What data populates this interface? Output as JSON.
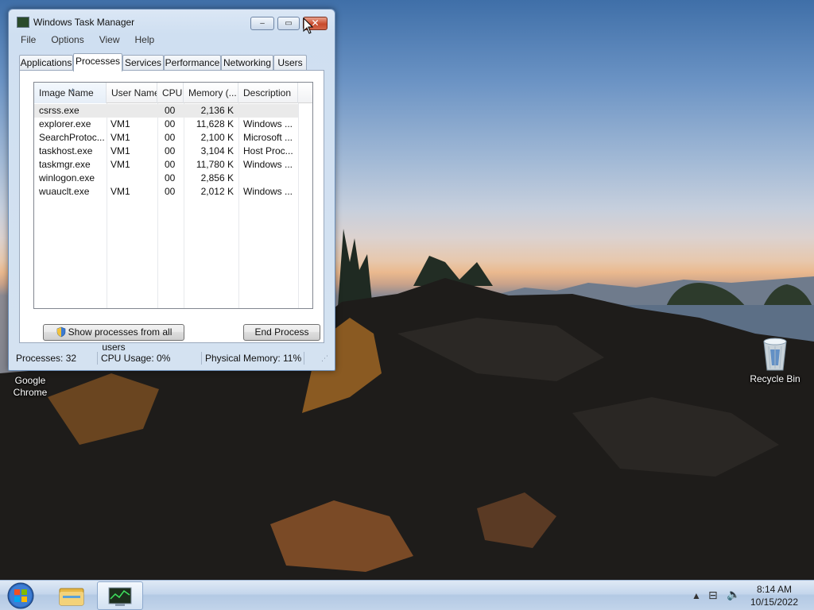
{
  "desktop": {
    "icons": [
      {
        "label_line1": "Google",
        "label_line2": "Chrome",
        "icon": "chrome-icon"
      },
      {
        "label_line1": "Recycle Bin",
        "icon": "recycle-bin-icon"
      }
    ]
  },
  "window": {
    "title": "Windows Task Manager",
    "controls": {
      "minimize": "–",
      "maximize": "▭",
      "close": "✕"
    },
    "menu": [
      "File",
      "Options",
      "View",
      "Help"
    ],
    "tabs": [
      "Applications",
      "Processes",
      "Services",
      "Performance",
      "Networking",
      "Users"
    ],
    "selected_tab": "Processes",
    "columns": [
      "Image Name",
      "User Name",
      "CPU",
      "Memory (...",
      "Description"
    ],
    "rows": [
      {
        "image": "csrss.exe",
        "user": "",
        "cpu": "00",
        "memory": "2,136 K",
        "desc": ""
      },
      {
        "image": "explorer.exe",
        "user": "VM1",
        "cpu": "00",
        "memory": "11,628 K",
        "desc": "Windows ..."
      },
      {
        "image": "SearchProtoc...",
        "user": "VM1",
        "cpu": "00",
        "memory": "2,100 K",
        "desc": "Microsoft ..."
      },
      {
        "image": "taskhost.exe",
        "user": "VM1",
        "cpu": "00",
        "memory": "3,104 K",
        "desc": "Host Proc..."
      },
      {
        "image": "taskmgr.exe",
        "user": "VM1",
        "cpu": "00",
        "memory": "11,780 K",
        "desc": "Windows ..."
      },
      {
        "image": "winlogon.exe",
        "user": "",
        "cpu": "00",
        "memory": "2,856 K",
        "desc": ""
      },
      {
        "image": "wuauclt.exe",
        "user": "VM1",
        "cpu": "00",
        "memory": "2,012 K",
        "desc": "Windows ..."
      }
    ],
    "buttons": {
      "show_all": "Show processes from all users",
      "end_process": "End Process"
    },
    "status": {
      "processes": "Processes: 32",
      "cpu": "CPU Usage: 0%",
      "memory": "Physical Memory: 11%"
    }
  },
  "taskbar": {
    "clock_time": "8:14 AM",
    "clock_date": "10/15/2022"
  }
}
